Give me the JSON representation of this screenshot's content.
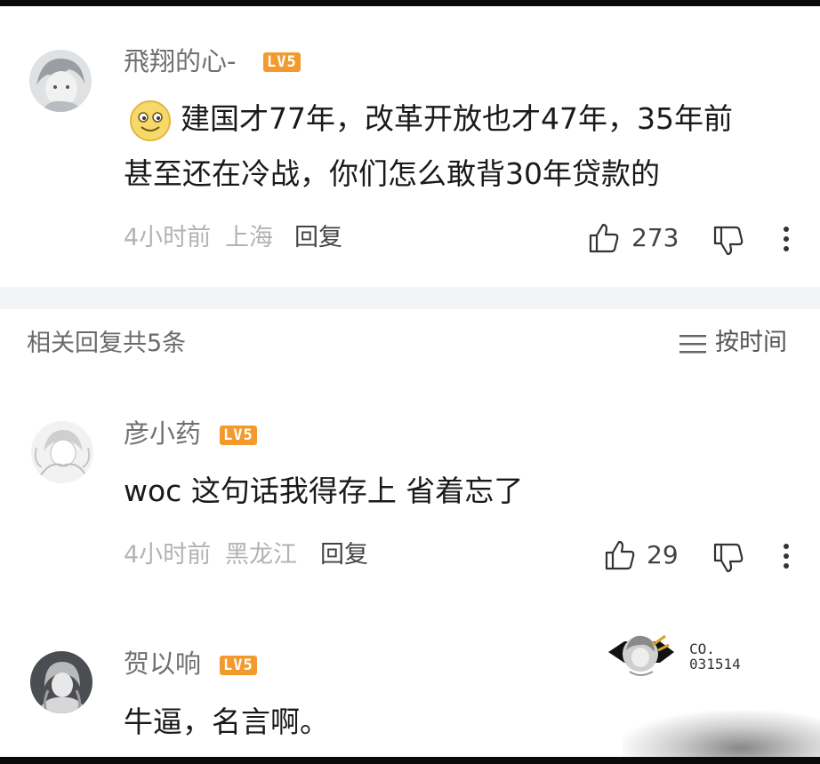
{
  "comment": {
    "username": "飛翔的心-",
    "level": "LV5",
    "emoji": "smiling-face-emoji",
    "text_line1": "建国才77年，改革开放也才47年，35年前",
    "text_line2": "甚至还在冷战，你们怎么敢背30年贷款的",
    "time": "4小时前",
    "location": "上海",
    "reply_label": "回复",
    "likes": "273"
  },
  "replies_header": {
    "title": "相关回复共5条",
    "sort_label": "按时间"
  },
  "replies": [
    {
      "username": "彦小药",
      "level": "LV5",
      "text": "woc 这句话我得存上 省着忘了",
      "time": "4小时前",
      "location": "黑龙江",
      "reply_label": "回复",
      "likes": "29"
    },
    {
      "username": "贺以响",
      "level": "LV5",
      "text": "牛逼，名言啊。"
    }
  ],
  "watermark": {
    "text": "CO.\n031514"
  },
  "colors": {
    "level_badge": "#f29a2e",
    "divider": "#f3f4f6",
    "meta_text": "#b3b3b3"
  }
}
